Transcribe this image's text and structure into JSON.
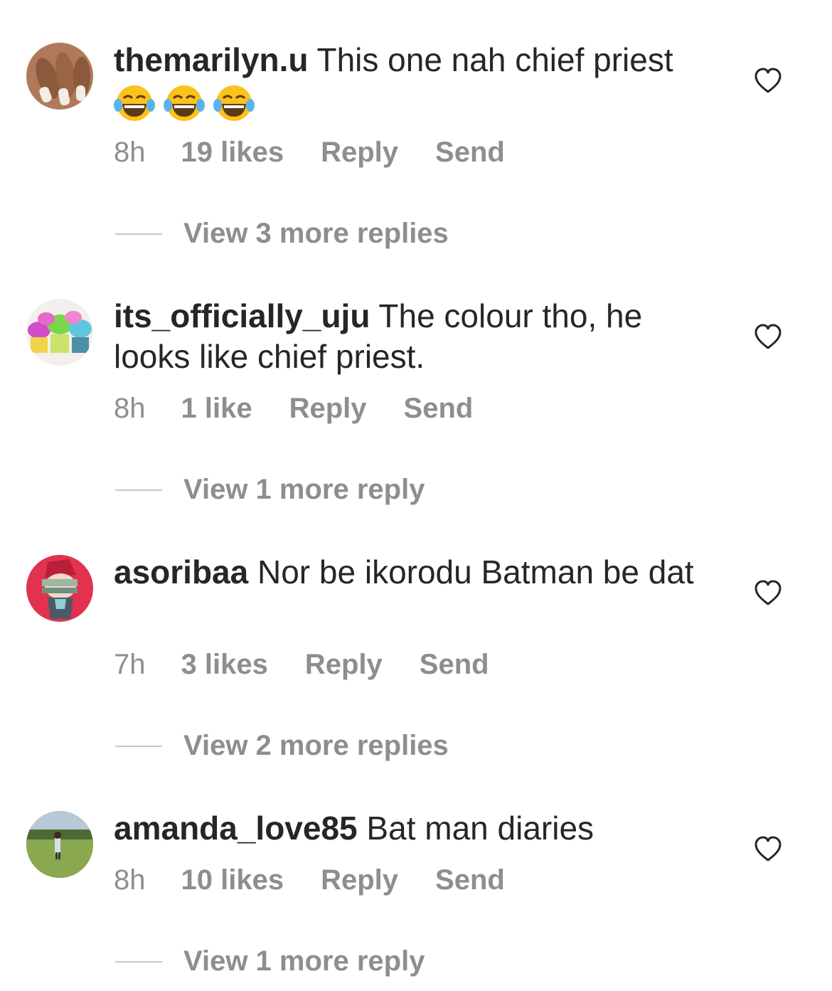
{
  "comments": [
    {
      "username": "themarilyn.u",
      "text": " This one nah chief priest",
      "emoji": "😂😂😂",
      "time": "8h",
      "likes": "19 likes",
      "reply": "Reply",
      "send": "Send",
      "view_replies": "View 3 more replies",
      "avatar_icon": "nails-photo-avatar"
    },
    {
      "username": "its_officially_uju",
      "text": " The colour tho, he looks like chief priest.",
      "time": "8h",
      "likes": "1 like",
      "reply": "Reply",
      "send": "Send",
      "view_replies": "View 1 more reply",
      "avatar_icon": "cupcakes-photo-avatar"
    },
    {
      "username": "asoribaa",
      "text": " Nor be ikorodu Batman be dat",
      "time": "7h",
      "likes": "3 likes",
      "reply": "Reply",
      "send": "Send",
      "view_replies": "View 2 more replies",
      "avatar_icon": "illustration-avatar"
    },
    {
      "username": "amanda_love85",
      "text": " Bat man diaries",
      "time": "8h",
      "likes": "10 likes",
      "reply": "Reply",
      "send": "Send",
      "view_replies": "View 1 more reply",
      "avatar_icon": "park-photo-avatar"
    }
  ],
  "colors": {
    "text": "#262626",
    "secondary": "#8e8e8e",
    "divider": "#c7c7c7"
  }
}
